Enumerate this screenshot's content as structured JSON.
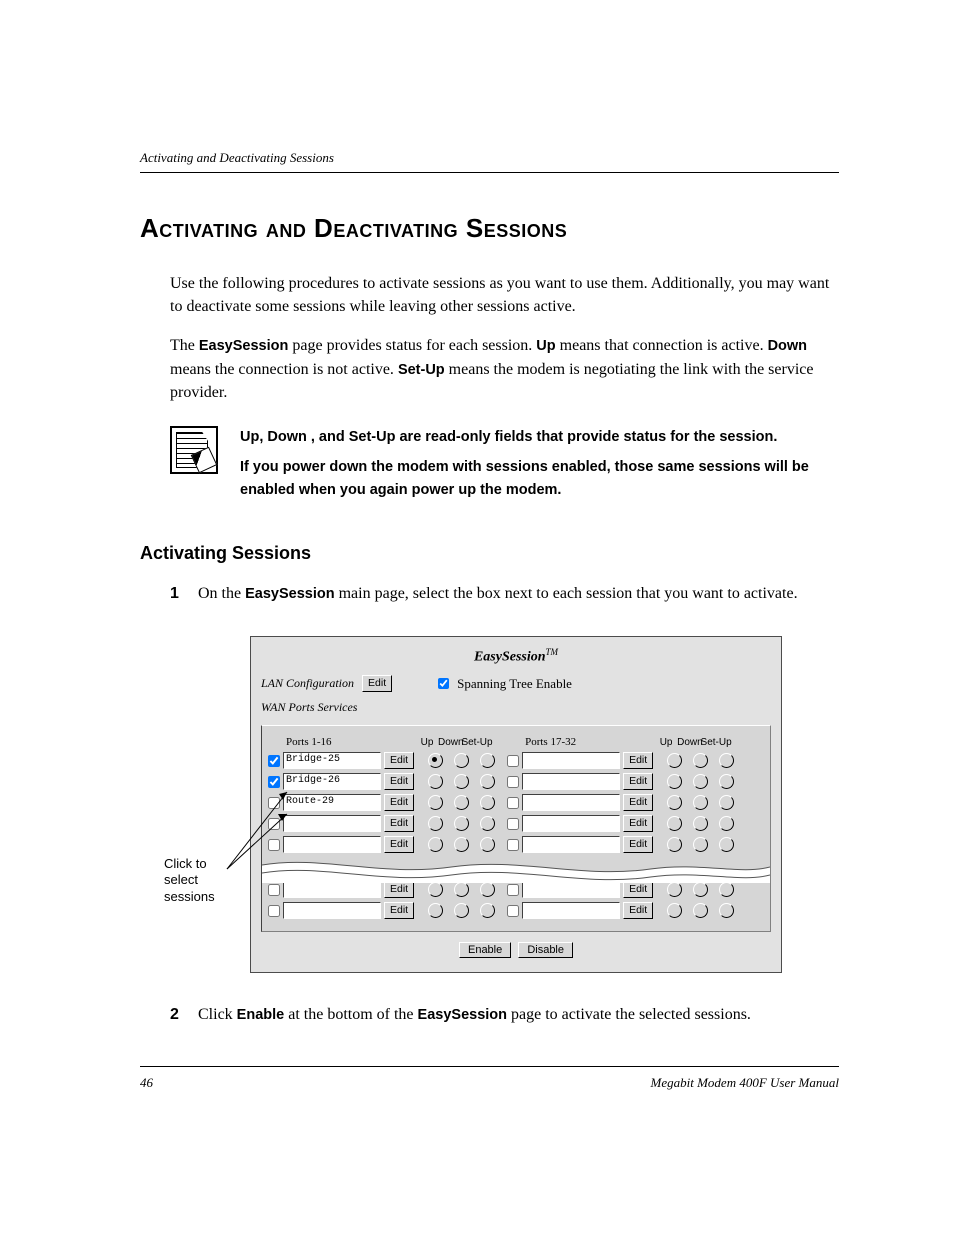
{
  "header": {
    "running": "Activating and Deactivating Sessions"
  },
  "title": "Activating and Deactivating Sessions",
  "para1_a": "Use the following procedures to activate sessions as you want to use them. Additionally, you may want to deactivate some sessions while leaving other sessions active.",
  "para2": {
    "a": "The ",
    "b": "EasySession",
    "c": " page provides status for each session. ",
    "d": "Up",
    "e": " means that connection is active. ",
    "f": "Down",
    "g": " means the connection is not active. ",
    "h": "Set-Up",
    "i": " means the modem is negotiating the link with the service provider."
  },
  "note": {
    "l1": "Up, Down , and Set-Up are read-only fields that provide status for the session.",
    "l2": "If you power down the modem with sessions enabled, those same sessions will be enabled when you again power up the modem."
  },
  "sub": "Activating Sessions",
  "steps": {
    "n1": "1",
    "s1": {
      "a": "On the ",
      "b": "EasySession",
      "c": " main page, select the box next to each session that you want to activate."
    },
    "n2": "2",
    "s2": {
      "a": "Click ",
      "b": "Enable",
      "c": " at the bottom of the ",
      "d": "EasySession",
      "e": " page to activate the selected sessions."
    }
  },
  "callout": "Click to select sessions",
  "fig": {
    "title": "EasySession",
    "tm": "TM",
    "lan": "LAN Configuration",
    "edit": "Edit",
    "stp": "Spanning Tree Enable",
    "wan": "WAN Ports Services",
    "ports1": "Ports 1-16",
    "ports2": "Ports 17-32",
    "up": "Up",
    "down": "Down",
    "setup": "Set-Up",
    "rows": [
      {
        "chk": true,
        "name": "Bridge-25",
        "upsel": true
      },
      {
        "chk": true,
        "name": "Bridge-26",
        "upsel": false
      },
      {
        "chk": false,
        "name": "Route-29",
        "upsel": false
      },
      {
        "chk": false,
        "name": "",
        "upsel": false
      },
      {
        "chk": false,
        "name": "",
        "upsel": false
      }
    ],
    "rowsB": [
      {
        "chk": false,
        "name": ""
      },
      {
        "chk": false,
        "name": ""
      }
    ],
    "enable": "Enable",
    "disable": "Disable"
  },
  "footer": {
    "page": "46",
    "title": "Megabit Modem 400F User Manual"
  }
}
